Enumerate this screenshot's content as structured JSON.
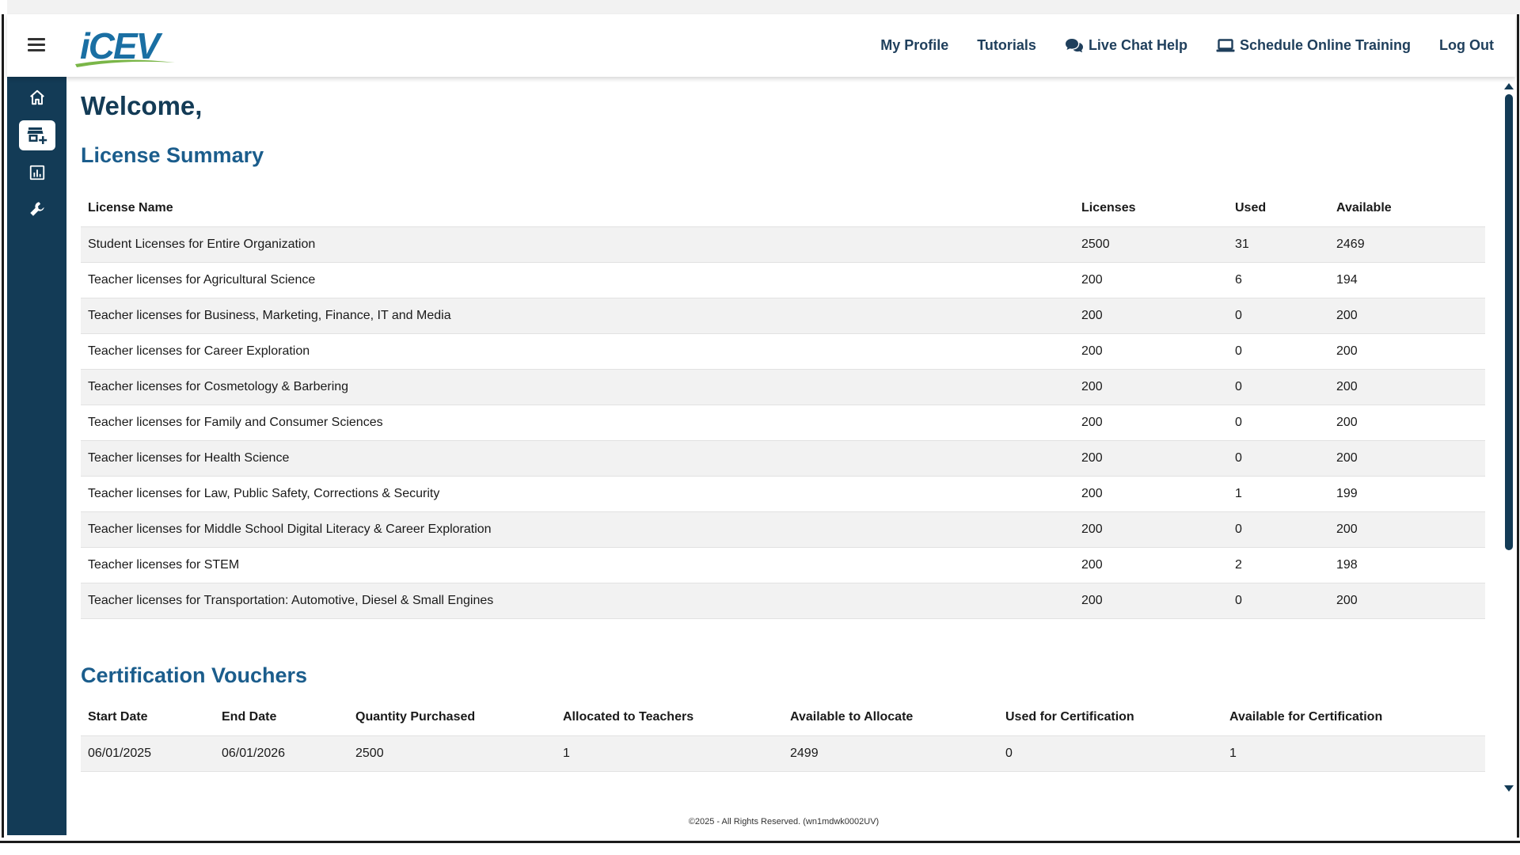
{
  "header": {
    "logo_text": "iCEV",
    "nav": [
      {
        "label": "My Profile",
        "icon": ""
      },
      {
        "label": "Tutorials",
        "icon": ""
      },
      {
        "label": "Live Chat Help",
        "icon": "chat-bubbles-icon"
      },
      {
        "label": "Schedule Online Training",
        "icon": "laptop-icon"
      },
      {
        "label": "Log Out",
        "icon": ""
      }
    ]
  },
  "sidebar": {
    "items": [
      {
        "icon": "home-icon",
        "active": false
      },
      {
        "icon": "storefront-add-icon",
        "active": true
      },
      {
        "icon": "report-chart-icon",
        "active": false
      },
      {
        "icon": "wrench-tools-icon",
        "active": false
      }
    ]
  },
  "main": {
    "welcome": "Welcome,",
    "license_summary": {
      "title": "License Summary",
      "columns": [
        "License Name",
        "Licenses",
        "Used",
        "Available"
      ],
      "rows": [
        [
          "Student Licenses for Entire Organization",
          "2500",
          "31",
          "2469"
        ],
        [
          "Teacher licenses for Agricultural Science",
          "200",
          "6",
          "194"
        ],
        [
          "Teacher licenses for Business, Marketing, Finance, IT and Media",
          "200",
          "0",
          "200"
        ],
        [
          "Teacher licenses for Career Exploration",
          "200",
          "0",
          "200"
        ],
        [
          "Teacher licenses for Cosmetology & Barbering",
          "200",
          "0",
          "200"
        ],
        [
          "Teacher licenses for Family and Consumer Sciences",
          "200",
          "0",
          "200"
        ],
        [
          "Teacher licenses for Health Science",
          "200",
          "0",
          "200"
        ],
        [
          "Teacher licenses for Law, Public Safety, Corrections & Security",
          "200",
          "1",
          "199"
        ],
        [
          "Teacher licenses for Middle School Digital Literacy & Career Exploration",
          "200",
          "0",
          "200"
        ],
        [
          "Teacher licenses for STEM",
          "200",
          "2",
          "198"
        ],
        [
          "Teacher licenses for Transportation: Automotive, Diesel & Small Engines",
          "200",
          "0",
          "200"
        ]
      ]
    },
    "certification_vouchers": {
      "title": "Certification Vouchers",
      "columns": [
        "Start Date",
        "End Date",
        "Quantity Purchased",
        "Allocated to Teachers",
        "Available to Allocate",
        "Used for Certification",
        "Available for Certification"
      ],
      "rows": [
        [
          "06/01/2025",
          "06/01/2026",
          "2500",
          "1",
          "2499",
          "0",
          "1"
        ]
      ]
    },
    "footer": "©2025 - All Rights Reserved. (wn1mdwk0002UV)"
  },
  "colors": {
    "sidebar": "#133b56",
    "heading": "#1b5d8c",
    "welcome": "#133b56",
    "nav_text": "#1f3f5c",
    "row_stripe": "#f2f2f2"
  }
}
